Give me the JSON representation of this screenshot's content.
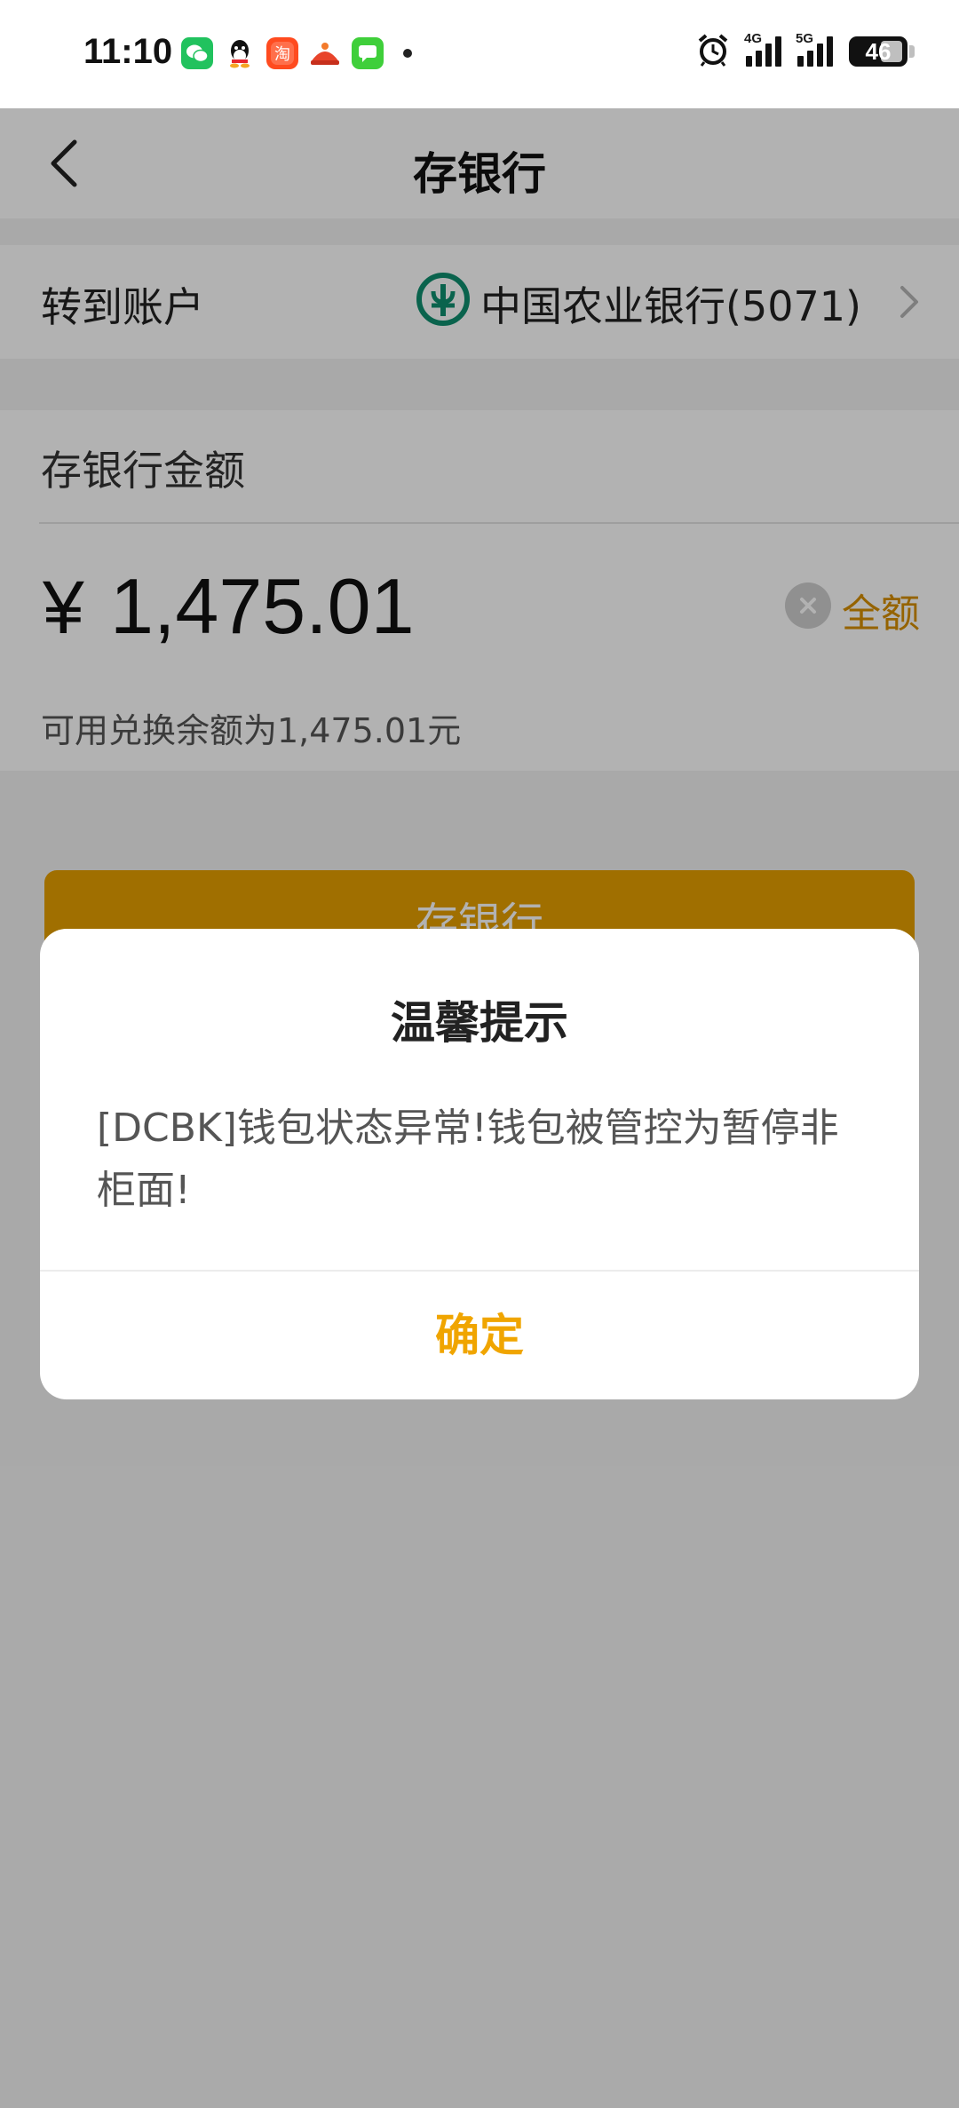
{
  "status_bar": {
    "time": "11:10",
    "notifications": [
      "wechat-icon",
      "qq-icon",
      "taobao-icon",
      "app-icon",
      "message-icon"
    ],
    "net1": "4G",
    "net2": "5G",
    "battery": "46"
  },
  "nav": {
    "title": "存银行"
  },
  "account": {
    "label": "转到账户",
    "bank": "中国农业银行(5071)"
  },
  "amount": {
    "label": "存银行金额",
    "currency": "¥",
    "value": "1,475.01",
    "all_label": "全额",
    "available": "可用兑换余额为1,475.01元"
  },
  "submit": {
    "label": "存银行"
  },
  "dialog": {
    "title": "温馨提示",
    "message": "[DCBK]钱包状态异常!钱包被管控为暂停非柜面!",
    "confirm": "确定"
  },
  "colors": {
    "accent": "#e59f00",
    "confirm": "#f0a500",
    "bank_green": "#0f8f6f"
  }
}
